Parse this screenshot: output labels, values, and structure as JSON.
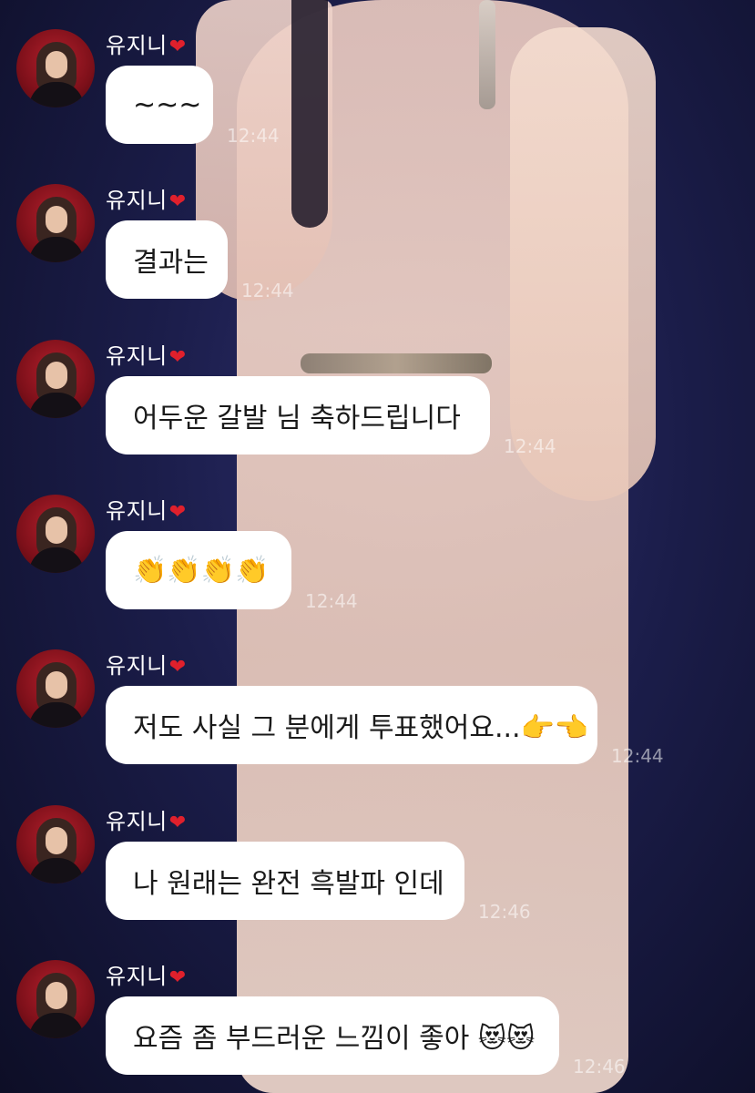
{
  "sender": {
    "name": "유지니",
    "heart": "❤"
  },
  "messages": [
    {
      "text": "~~~",
      "time": "12:44"
    },
    {
      "text": "결과는",
      "time": "12:44"
    },
    {
      "text": "어두운 갈발 님 축하드립니다",
      "time": "12:44"
    },
    {
      "text": "👏👏👏👏",
      "time": "12:44"
    },
    {
      "text": "저도 사실 그 분에게 투표했어요...👉👈",
      "time": "12:44"
    },
    {
      "text": "나 원래는 완전 흑발파 인데",
      "time": "12:46"
    },
    {
      "text": "요즘 좀 부드러운 느낌이 좋아 😻😻",
      "time": "12:46"
    }
  ]
}
